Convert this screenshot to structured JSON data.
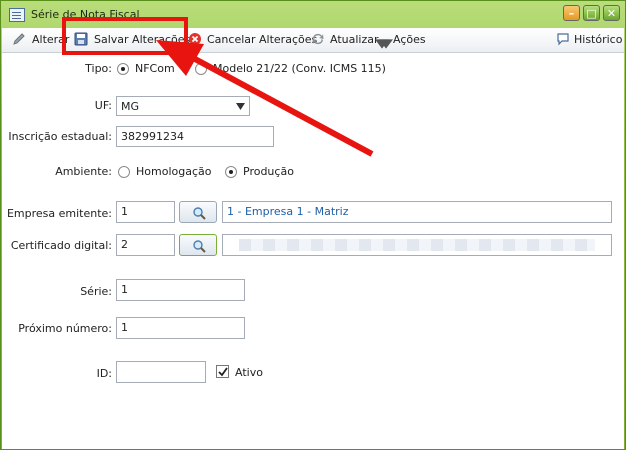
{
  "window": {
    "title": "Série de Nota Fiscal"
  },
  "toolbar": {
    "alterar_label": "Alterar",
    "salvar_label": "Salvar Alterações",
    "cancelar_label": "Cancelar Alterações",
    "atualizar_label": "Atualizar",
    "acoes_label": "Ações",
    "historico_label": "Histórico"
  },
  "form": {
    "tipo": {
      "label": "Tipo:",
      "options": [
        "NFCom",
        "Modelo 21/22 (Conv. ICMS 115)"
      ],
      "selected": "NFCom"
    },
    "uf": {
      "label": "UF:",
      "value": "MG"
    },
    "inscricao": {
      "label": "Inscrição estadual:",
      "value": "382991234"
    },
    "ambiente": {
      "label": "Ambiente:",
      "options": [
        "Homologação",
        "Produção"
      ],
      "selected": "Produção"
    },
    "empresa": {
      "label": "Empresa emitente:",
      "code": "1",
      "description": "1 - Empresa 1 - Matriz"
    },
    "certificado": {
      "label": "Certificado digital:",
      "code": "2"
    },
    "serie": {
      "label": "Série:",
      "value": "1"
    },
    "proximo": {
      "label": "Próximo número:",
      "value": "1"
    },
    "id": {
      "label": "ID:",
      "value": ""
    },
    "ativo": {
      "label": "Ativo",
      "checked": true
    }
  },
  "colors": {
    "title_bar": "#8fc243",
    "highlight": "#e8140f",
    "link_text": "#1f5fa8"
  },
  "icons": [
    "window-icon",
    "minimize-icon",
    "maximize-icon",
    "close-icon",
    "pencil-icon",
    "save-disk-icon",
    "cancel-x-icon",
    "refresh-icon",
    "dropdown-arrow-icon",
    "history-chat-icon",
    "magnifier-icon",
    "check-icon",
    "annotation-arrow"
  ]
}
